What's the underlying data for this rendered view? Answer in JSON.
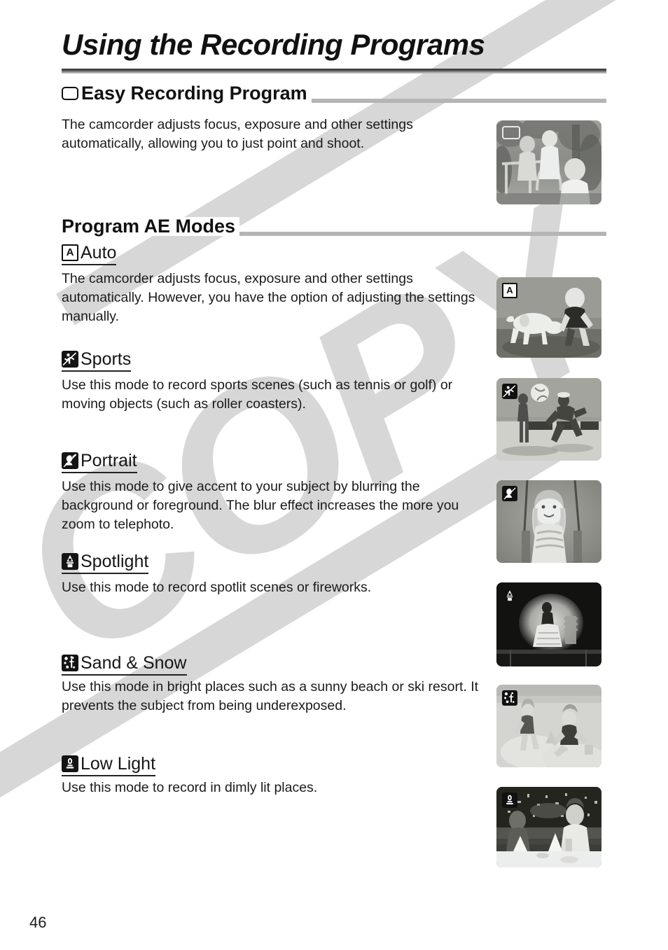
{
  "page": {
    "title": "Using the Recording Programs",
    "number": "46",
    "watermark": "COPY"
  },
  "sections": [
    {
      "id": "easy-recording-program",
      "heading": "Easy Recording Program",
      "icon": "rounded-rectangle-icon",
      "body": "The camcorder adjusts focus, exposure and other settings automatically, allowing you to just point and shoot.",
      "thumbnail": {
        "name": "easy-recording-thumbnail",
        "caption": "children on playground",
        "badge": "rounded-rectangle-icon"
      }
    },
    {
      "id": "program-ae-modes",
      "heading": "Program AE Modes"
    }
  ],
  "modes": [
    {
      "id": "auto",
      "label": "Auto",
      "icon": "auto-a-icon",
      "body": "The camcorder adjusts focus, exposure and other settings automatically. However, you have the option of adjusting the settings manually.",
      "thumbnail": {
        "name": "auto-thumbnail",
        "caption": "boy playing with white dog",
        "badge": "auto-a-icon"
      }
    },
    {
      "id": "sports",
      "label": "Sports",
      "icon": "sports-runner-icon",
      "body": "Use this mode to record sports scenes (such as tennis or golf) or moving objects (such as roller coasters).",
      "thumbnail": {
        "name": "sports-thumbnail",
        "caption": "beach volleyball players",
        "badge": "sports-runner-icon"
      }
    },
    {
      "id": "portrait",
      "label": "Portrait",
      "icon": "portrait-head-icon",
      "body": "Use this mode to give accent to your subject by blurring the background or foreground. The blur effect increases the more you zoom to telephoto.",
      "thumbnail": {
        "name": "portrait-thumbnail",
        "caption": "girl on a swing",
        "badge": "portrait-head-icon"
      }
    },
    {
      "id": "spotlight",
      "label": "Spotlight",
      "icon": "spotlight-lamp-icon",
      "body": "Use this mode to record spotlit scenes or fireworks.",
      "thumbnail": {
        "name": "spotlight-thumbnail",
        "caption": "performer on dark stage under spotlight",
        "badge": "spotlight-lamp-icon"
      }
    },
    {
      "id": "sand-and-snow",
      "label": "Sand & Snow",
      "icon": "sand-snow-icon",
      "body": "Use this mode in bright places such as a sunny beach or ski resort. It prevents the subject from being underexposed.",
      "thumbnail": {
        "name": "sand-and-snow-thumbnail",
        "caption": "two children playing in beach sand",
        "badge": "sand-snow-icon"
      }
    },
    {
      "id": "low-light",
      "label": "Low Light",
      "icon": "low-light-candle-icon",
      "body": "Use this mode to record in dimly lit places.",
      "thumbnail": {
        "name": "low-light-thumbnail",
        "caption": "man at restaurant table at night",
        "badge": "low-light-candle-icon"
      }
    }
  ],
  "colors": {
    "text": "#1b1b1b",
    "rule_gray": "#b5b5b5",
    "watermark_gray": "#d7d7d7",
    "title_rule_dark": "#3a3a3a"
  }
}
